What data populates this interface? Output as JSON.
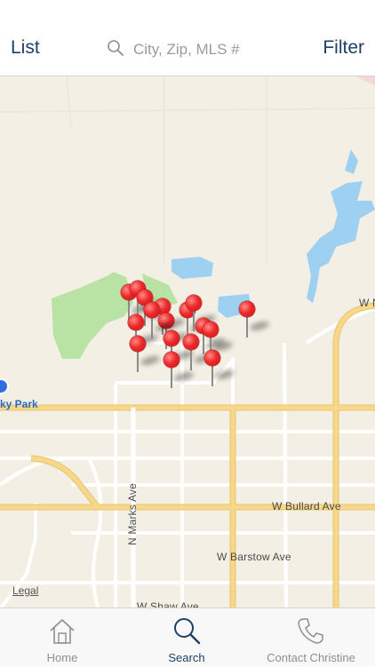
{
  "navbar": {
    "left_label": "List",
    "search_placeholder": "City, Zip, MLS #",
    "right_label": "Filter"
  },
  "map": {
    "streets": [
      "W Bullard Ave",
      "W Barstow Ave",
      "W Shaw Ave",
      "N Marks Ave",
      "W N"
    ],
    "park_label": "ky Park",
    "legal_label": "Legal",
    "pin_count": 17
  },
  "tabs": [
    {
      "label": "Home",
      "icon": "home-icon",
      "active": false
    },
    {
      "label": "Search",
      "icon": "search-icon",
      "active": true
    },
    {
      "label": "Contact Christine",
      "icon": "phone-icon",
      "active": false
    }
  ],
  "colors": {
    "accent": "#1d3f66",
    "pin": "#ee2a2a",
    "map_background": "#f4efe5",
    "park": "#b9e3a4",
    "water": "#9ed0f2",
    "major_road": "#f7d78a"
  }
}
